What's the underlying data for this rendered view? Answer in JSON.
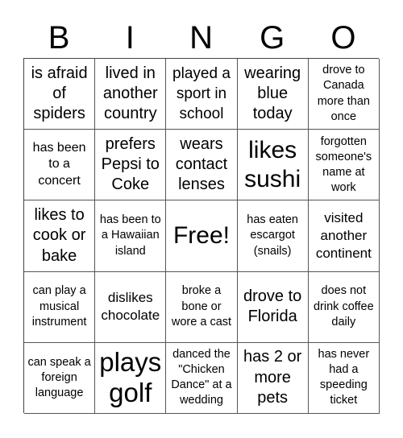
{
  "header": [
    "B",
    "I",
    "N",
    "G",
    "O"
  ],
  "cells": [
    {
      "text": "is afraid of spiders",
      "size": "s20"
    },
    {
      "text": "lived in another country",
      "size": "s20"
    },
    {
      "text": "played a sport in school",
      "size": "s19"
    },
    {
      "text": "wearing blue today",
      "size": "s20"
    },
    {
      "text": "drove to Canada more than once",
      "size": "s14"
    },
    {
      "text": "has been to a concert",
      "size": "s16"
    },
    {
      "text": "prefers Pepsi to Coke",
      "size": "s20"
    },
    {
      "text": "wears contact lenses",
      "size": "s20"
    },
    {
      "text": "likes sushi",
      "size": "s30"
    },
    {
      "text": "forgotten someone's name at work",
      "size": "s14"
    },
    {
      "text": "likes to cook or bake",
      "size": "s20"
    },
    {
      "text": "has been to a Hawaiian island",
      "size": "s14"
    },
    {
      "text": "Free!",
      "size": "s30"
    },
    {
      "text": "has eaten escargot (snails)",
      "size": "s14"
    },
    {
      "text": "visited another continent",
      "size": "s17"
    },
    {
      "text": "can play a musical instrument",
      "size": "s14"
    },
    {
      "text": "dislikes chocolate",
      "size": "s17"
    },
    {
      "text": "broke a bone or wore a cast",
      "size": "s14"
    },
    {
      "text": "drove to Florida",
      "size": "s20"
    },
    {
      "text": "does not drink coffee daily",
      "size": "s14"
    },
    {
      "text": "can speak a foreign language",
      "size": "s14"
    },
    {
      "text": "plays golf",
      "size": "s34"
    },
    {
      "text": "danced the \"Chicken Dance\" at a wedding",
      "size": "s14"
    },
    {
      "text": "has 2 or more pets",
      "size": "s20"
    },
    {
      "text": "has never had a speeding ticket",
      "size": "s14"
    }
  ]
}
